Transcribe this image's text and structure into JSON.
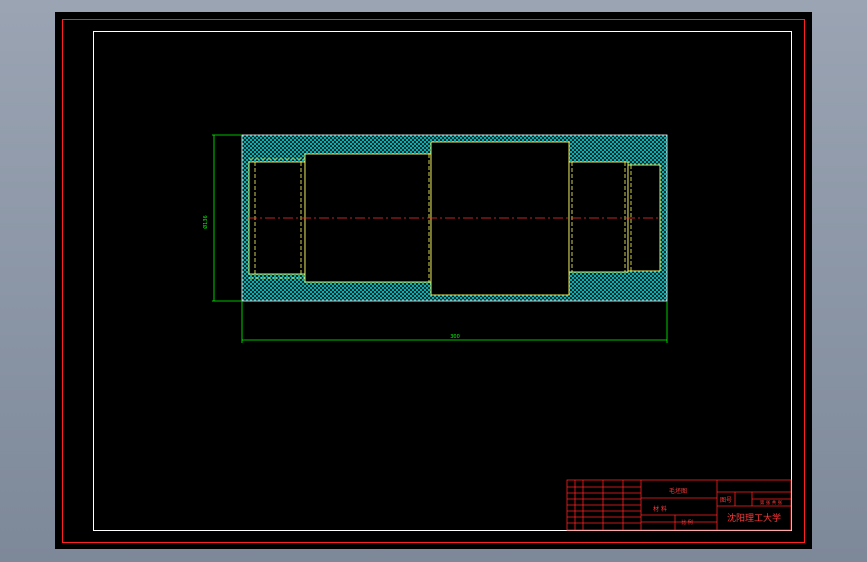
{
  "drawing": {
    "dim_height": "Ø136",
    "dim_length": "300"
  },
  "title_block": {
    "part_name": "毛坯图",
    "material_label": "材 料",
    "scale_label": "比 例",
    "drawing_no_label": "图号",
    "school": "沈阳理工大学",
    "sheet_info": "第 张 共 张",
    "weight_label": "重量",
    "scale_value": "1:1"
  },
  "colors": {
    "background": "#000000",
    "frame": "#ff2020",
    "inner_frame": "#ffffff",
    "hatch": "#00d8d8",
    "outline": "#ffff66",
    "dimension": "#00ff00",
    "centerline": "#ff3030"
  }
}
